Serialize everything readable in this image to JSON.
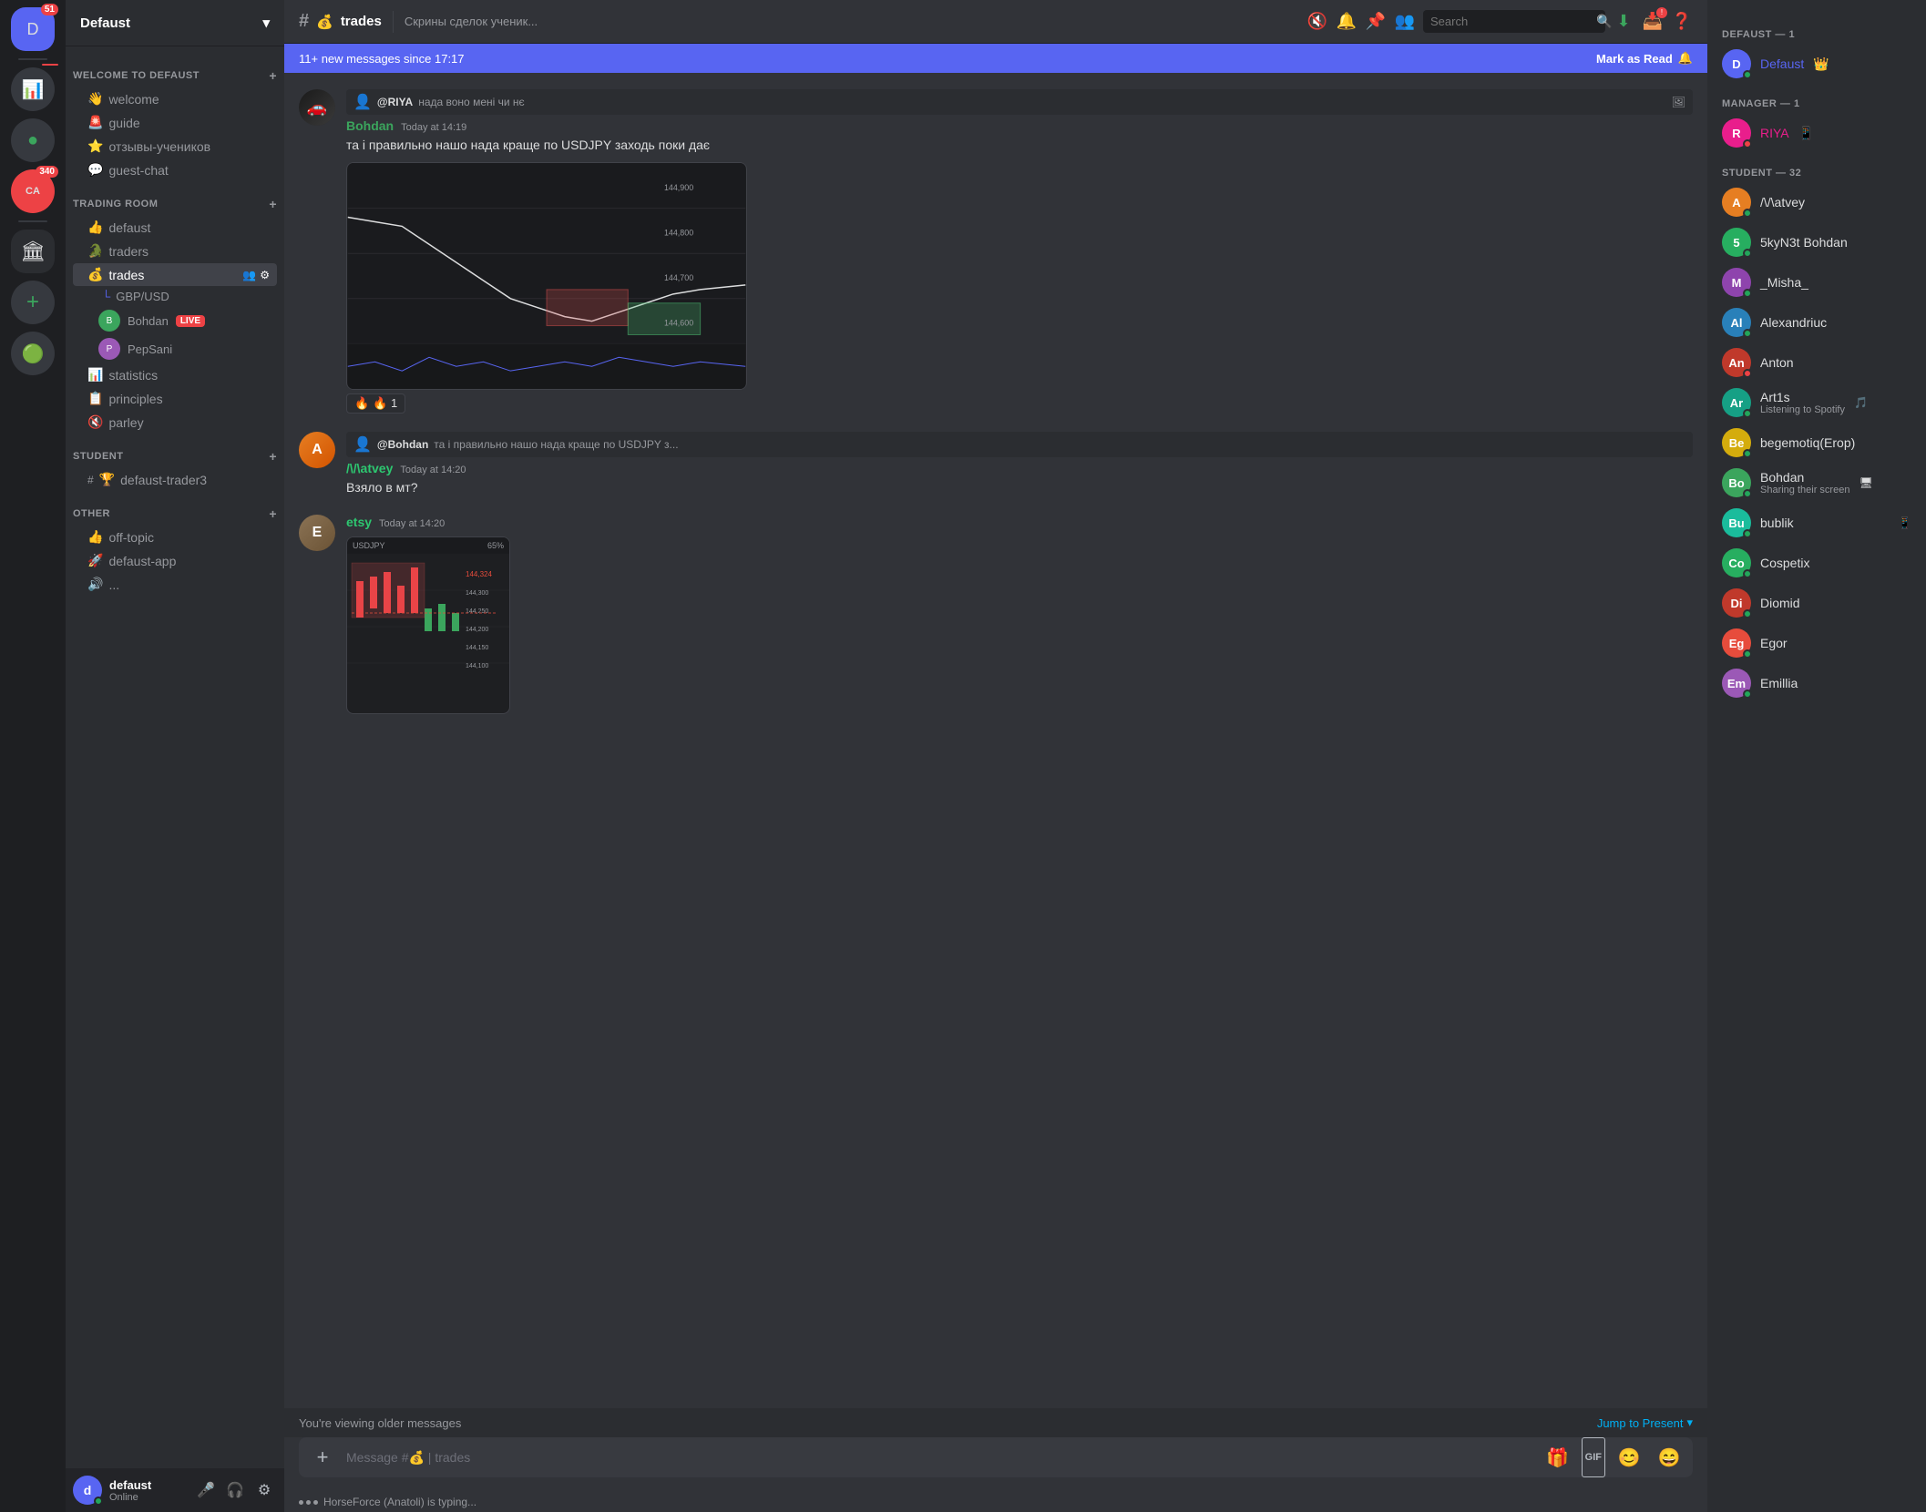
{
  "servers": [
    {
      "id": "defaust",
      "label": "D",
      "active": true,
      "badge": "51",
      "color": "#5865f2"
    },
    {
      "id": "server2",
      "label": "📊",
      "active": false,
      "badge": null,
      "color": "#ed4245"
    },
    {
      "id": "server3",
      "label": "🔵",
      "active": false,
      "badge": null,
      "color": "#3ba55d"
    },
    {
      "id": "server4",
      "label": "CA",
      "active": false,
      "badge": "340",
      "color": "#f0b232"
    },
    {
      "id": "add",
      "label": "+",
      "active": false,
      "badge": null,
      "color": "#36393f"
    }
  ],
  "channel_sidebar": {
    "server_name": "Defaust",
    "categories": [
      {
        "id": "welcome",
        "label": "WELCOME TO DEFAUST",
        "channels": [
          {
            "id": "welcome",
            "emoji": "👋",
            "name": "welcome",
            "active": false
          },
          {
            "id": "guide",
            "emoji": "🚨",
            "name": "guide",
            "active": false
          },
          {
            "id": "reviews",
            "emoji": "⭐",
            "name": "отзывы-учеников",
            "active": false
          },
          {
            "id": "guest-chat",
            "emoji": "💬",
            "name": "guest-chat",
            "active": false
          }
        ]
      },
      {
        "id": "trading-room",
        "label": "TRADING ROOM",
        "channels": [
          {
            "id": "defaust",
            "emoji": "👍",
            "name": "defaust",
            "active": false
          },
          {
            "id": "traders",
            "emoji": "🐊",
            "name": "traders",
            "active": false
          },
          {
            "id": "trades",
            "emoji": "💰",
            "name": "trades",
            "active": true,
            "sub_channels": [
              {
                "name": "GBP/USD"
              }
            ],
            "voice_users": [
              {
                "name": "Bohdan",
                "live": true
              },
              {
                "name": "PepSani",
                "live": false
              }
            ]
          },
          {
            "id": "statistics",
            "emoji": "📊",
            "name": "statistics",
            "active": false
          },
          {
            "id": "principles",
            "emoji": "📋",
            "name": "principles",
            "active": false
          },
          {
            "id": "parley",
            "emoji": "🔊",
            "name": "parley",
            "active": false,
            "muted": true
          }
        ]
      },
      {
        "id": "student",
        "label": "STUDENT",
        "channels": [
          {
            "id": "defaust-trader3",
            "emoji": "🏆",
            "name": "defaust-trader3",
            "active": false
          }
        ]
      },
      {
        "id": "other",
        "label": "OTHER",
        "channels": [
          {
            "id": "off-topic",
            "emoji": "👍",
            "name": "off-topic",
            "active": false
          },
          {
            "id": "defaust-app",
            "emoji": "🚀",
            "name": "defaust-app",
            "active": false
          }
        ]
      }
    ],
    "user": {
      "name": "defaust",
      "status": "Online",
      "avatar_color": "#5865f2"
    }
  },
  "chat": {
    "channel_name": "trades",
    "channel_emoji": "💰",
    "channel_topic": "Скрины сделок ученик...",
    "new_messages_banner": "11+ new messages since 17:17",
    "mark_as_read": "Mark as Read",
    "messages": [
      {
        "id": "msg1",
        "reply_to": "@RIYA",
        "reply_text": "нада воно мені чи нє",
        "author": "Bohdan",
        "author_color": "green",
        "timestamp": "Today at 14:19",
        "text": "та і правильно нашо нада краще по USDJPY заходь поки дає",
        "has_chart": true,
        "reaction": "🔥 1",
        "avatar_color": "#3ba55d",
        "avatar_letter": "B"
      },
      {
        "id": "msg2",
        "reply_to": "@Bohdan",
        "reply_text": "та і правильно нашо нада краще по USDJPY з...",
        "author": "/\\/\\atvey",
        "author_color": "teal",
        "timestamp": "Today at 14:20",
        "text": "Взяло в мт?",
        "has_chart": false,
        "avatar_color": "#e67e22",
        "avatar_letter": "A"
      },
      {
        "id": "msg3",
        "author": "etsy",
        "author_color": "teal",
        "timestamp": "Today at 14:20",
        "text": "",
        "has_mobile_chart": true,
        "avatar_color": "#8b7355",
        "avatar_letter": "E"
      }
    ],
    "older_messages_text": "You're viewing older messages",
    "jump_to_present": "Jump to Present",
    "input_placeholder": "Message #💰 | trades",
    "typing_text": "HorseForce (Anatoli) is typing..."
  },
  "members": {
    "groups": [
      {
        "label": "DEFAUST — 1",
        "members": [
          {
            "name": "Defaust",
            "color": "defaust",
            "badge": "👑",
            "status": "online",
            "avatar_color": "#5865f2"
          }
        ]
      },
      {
        "label": "MANAGER — 1",
        "members": [
          {
            "name": "RIYA",
            "color": "manager",
            "badge": "📱",
            "status": "dnd",
            "avatar_color": "#e91e8c"
          }
        ]
      },
      {
        "label": "STUDENT — 32",
        "members": [
          {
            "name": "/\\/\\atvey",
            "color": "normal",
            "badge": "",
            "status": "online",
            "avatar_color": "#e67e22"
          },
          {
            "name": "5kyN3t Bohdan",
            "color": "normal",
            "badge": "",
            "status": "online",
            "avatar_color": "#27ae60"
          },
          {
            "name": "_Misha_",
            "color": "normal",
            "badge": "",
            "status": "online",
            "avatar_color": "#8e44ad"
          },
          {
            "name": "Alexandriuc",
            "color": "normal",
            "badge": "",
            "status": "online",
            "avatar_color": "#2980b9"
          },
          {
            "name": "Anton",
            "color": "normal",
            "badge": "",
            "status": "dnd",
            "avatar_color": "#c0392b"
          },
          {
            "name": "Art1s",
            "color": "normal",
            "badge": "🎵",
            "status": "online",
            "avatar_color": "#16a085",
            "activity": "Listening to Spotify"
          },
          {
            "name": "begemotiq(Erop)",
            "color": "normal",
            "badge": "",
            "status": "online",
            "avatar_color": "#d4ac0d"
          },
          {
            "name": "Bohdan",
            "color": "normal",
            "badge": "🖥",
            "status": "online",
            "avatar_color": "#3ba55d",
            "activity": "Sharing their screen"
          },
          {
            "name": "bublik",
            "color": "normal",
            "badge": "📱",
            "status": "online",
            "avatar_color": "#1abc9c"
          },
          {
            "name": "Cospetix",
            "color": "normal",
            "badge": "",
            "status": "online",
            "avatar_color": "#27ae60"
          },
          {
            "name": "Diomid",
            "color": "normal",
            "badge": "",
            "status": "online",
            "avatar_color": "#c0392b"
          },
          {
            "name": "Egor",
            "color": "normal",
            "badge": "",
            "status": "online",
            "avatar_color": "#e74c3c"
          },
          {
            "name": "Emillia",
            "color": "normal",
            "badge": "",
            "status": "online",
            "avatar_color": "#9b59b6"
          }
        ]
      }
    ]
  },
  "icons": {
    "hash": "#",
    "chevron_down": "▾",
    "search": "🔍",
    "download": "⬇",
    "inbox": "📥",
    "help": "❓",
    "pin": "📌",
    "bell": "🔔",
    "add_member": "👥",
    "settings": "⚙",
    "plus": "+",
    "mic": "🎤",
    "headphone": "🎧",
    "gear": "⚙",
    "gift": "🎁",
    "gif": "GIF",
    "emoji": "😊",
    "sticker": "😄"
  }
}
